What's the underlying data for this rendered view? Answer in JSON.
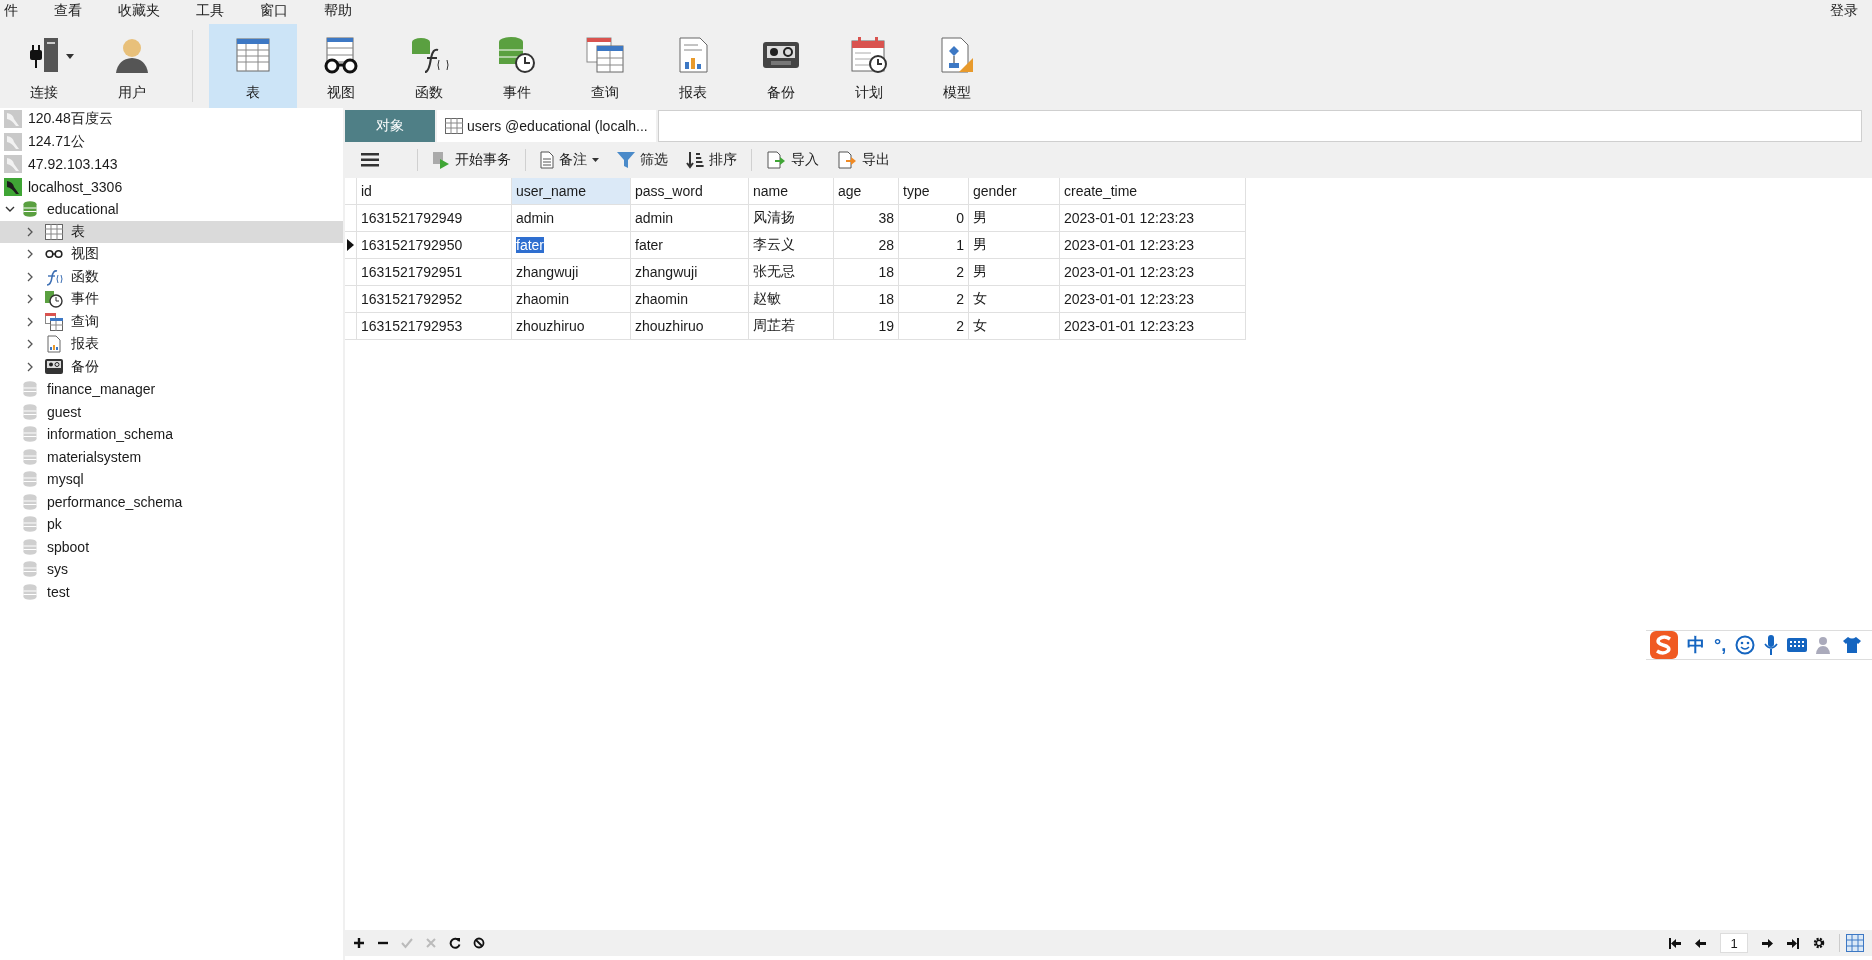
{
  "menu": {
    "items": [
      "件",
      "查看",
      "收藏夹",
      "工具",
      "窗口",
      "帮助"
    ],
    "login": "登录"
  },
  "toolbar": {
    "groups": [
      [
        {
          "label": "连接",
          "kind": "connection",
          "dropdown": true,
          "selected": false
        },
        {
          "label": "用户",
          "kind": "user",
          "dropdown": false,
          "selected": false
        }
      ],
      [
        {
          "label": "表",
          "kind": "table",
          "dropdown": false,
          "selected": true
        },
        {
          "label": "视图",
          "kind": "view",
          "dropdown": false,
          "selected": false
        },
        {
          "label": "函数",
          "kind": "function",
          "dropdown": false,
          "selected": false
        },
        {
          "label": "事件",
          "kind": "event",
          "dropdown": false,
          "selected": false
        },
        {
          "label": "查询",
          "kind": "query",
          "dropdown": false,
          "selected": false
        },
        {
          "label": "报表",
          "kind": "report",
          "dropdown": false,
          "selected": false
        },
        {
          "label": "备份",
          "kind": "backup",
          "dropdown": false,
          "selected": false
        },
        {
          "label": "计划",
          "kind": "schedule",
          "dropdown": false,
          "selected": false
        },
        {
          "label": "模型",
          "kind": "model",
          "dropdown": false,
          "selected": false
        }
      ]
    ]
  },
  "sidebar": {
    "connections": [
      {
        "label": "120.48百度云",
        "connected": false
      },
      {
        "label": "124.71公",
        "connected": false
      },
      {
        "label": "47.92.103.143",
        "connected": false
      },
      {
        "label": "localhost_3306",
        "connected": true,
        "children": [
          {
            "label": "educational",
            "open": true,
            "expanded": true,
            "children": [
              {
                "label": "表",
                "kind": "table",
                "expanded": false,
                "selected": true
              },
              {
                "label": "视图",
                "kind": "view",
                "expanded": false,
                "selected": false
              },
              {
                "label": "函数",
                "kind": "function",
                "expanded": false,
                "selected": false
              },
              {
                "label": "事件",
                "kind": "event",
                "expanded": false,
                "selected": false
              },
              {
                "label": "查询",
                "kind": "query",
                "expanded": false,
                "selected": false
              },
              {
                "label": "报表",
                "kind": "report",
                "expanded": false,
                "selected": false
              },
              {
                "label": "备份",
                "kind": "backup",
                "expanded": false,
                "selected": false
              }
            ]
          },
          {
            "label": "finance_manager",
            "open": false
          },
          {
            "label": "guest",
            "open": false
          },
          {
            "label": "information_schema",
            "open": false
          },
          {
            "label": "materialsystem",
            "open": false
          },
          {
            "label": "mysql",
            "open": false
          },
          {
            "label": "performance_schema",
            "open": false
          },
          {
            "label": "pk",
            "open": false
          },
          {
            "label": "spboot",
            "open": false
          },
          {
            "label": "sys",
            "open": false
          },
          {
            "label": "test",
            "open": false
          }
        ]
      }
    ]
  },
  "tabs": [
    {
      "label": "对象",
      "kind": "objects",
      "selected": false
    },
    {
      "label": "users @educational (localh...",
      "kind": "table",
      "selected": true
    }
  ],
  "table_toolbar": {
    "groups": [
      [
        {
          "kind": "menu",
          "dropdown": false
        }
      ],
      [
        {
          "label": "开始事务",
          "kind": "transaction",
          "dropdown": false
        }
      ],
      [
        {
          "label": "备注",
          "kind": "memo",
          "dropdown": true
        },
        {
          "label": "筛选",
          "kind": "filter",
          "dropdown": false
        },
        {
          "label": "排序",
          "kind": "sort",
          "dropdown": false
        }
      ],
      [
        {
          "label": "导入",
          "kind": "import",
          "dropdown": false
        },
        {
          "label": "导出",
          "kind": "export",
          "dropdown": false
        }
      ]
    ]
  },
  "table": {
    "columns": [
      {
        "label": "id",
        "numeric": false,
        "selected": false
      },
      {
        "label": "user_name",
        "numeric": false,
        "selected": true
      },
      {
        "label": "pass_word",
        "numeric": false,
        "selected": false
      },
      {
        "label": "name",
        "numeric": false,
        "selected": false
      },
      {
        "label": "age",
        "numeric": true,
        "selected": false
      },
      {
        "label": "type",
        "numeric": true,
        "selected": false
      },
      {
        "label": "gender",
        "numeric": false,
        "selected": false
      },
      {
        "label": "create_time",
        "numeric": false,
        "selected": false
      }
    ],
    "rows": [
      {
        "current": false,
        "cells": [
          "1631521792949",
          "admin",
          "admin",
          "风清扬",
          "38",
          "0",
          "男",
          "2023-01-01 12:23:23"
        ]
      },
      {
        "current": true,
        "cells": [
          "1631521792950",
          "fater",
          "fater",
          "李云义",
          "28",
          "1",
          "男",
          "2023-01-01 12:23:23"
        ]
      },
      {
        "current": false,
        "cells": [
          "1631521792951",
          "zhangwuji",
          "zhangwuji",
          "张无忌",
          "18",
          "2",
          "男",
          "2023-01-01 12:23:23"
        ]
      },
      {
        "current": false,
        "cells": [
          "1631521792952",
          "zhaomin",
          "zhaomin",
          "赵敏",
          "18",
          "2",
          "女",
          "2023-01-01 12:23:23"
        ]
      },
      {
        "current": false,
        "cells": [
          "1631521792953",
          "zhouzhiruo",
          "zhouzhiruo",
          "周芷若",
          "19",
          "2",
          "女",
          "2023-01-01 12:23:23"
        ]
      }
    ]
  },
  "bottom_bar": {
    "actions": [
      {
        "kind": "add",
        "disabled": false
      },
      {
        "kind": "remove",
        "disabled": false
      },
      {
        "kind": "apply",
        "disabled": true
      },
      {
        "kind": "discard",
        "disabled": true
      },
      {
        "kind": "refresh",
        "disabled": false
      },
      {
        "kind": "stop",
        "disabled": false
      }
    ],
    "page": "1"
  },
  "ime": {
    "mode": "中",
    "punctuation": "°,"
  }
}
